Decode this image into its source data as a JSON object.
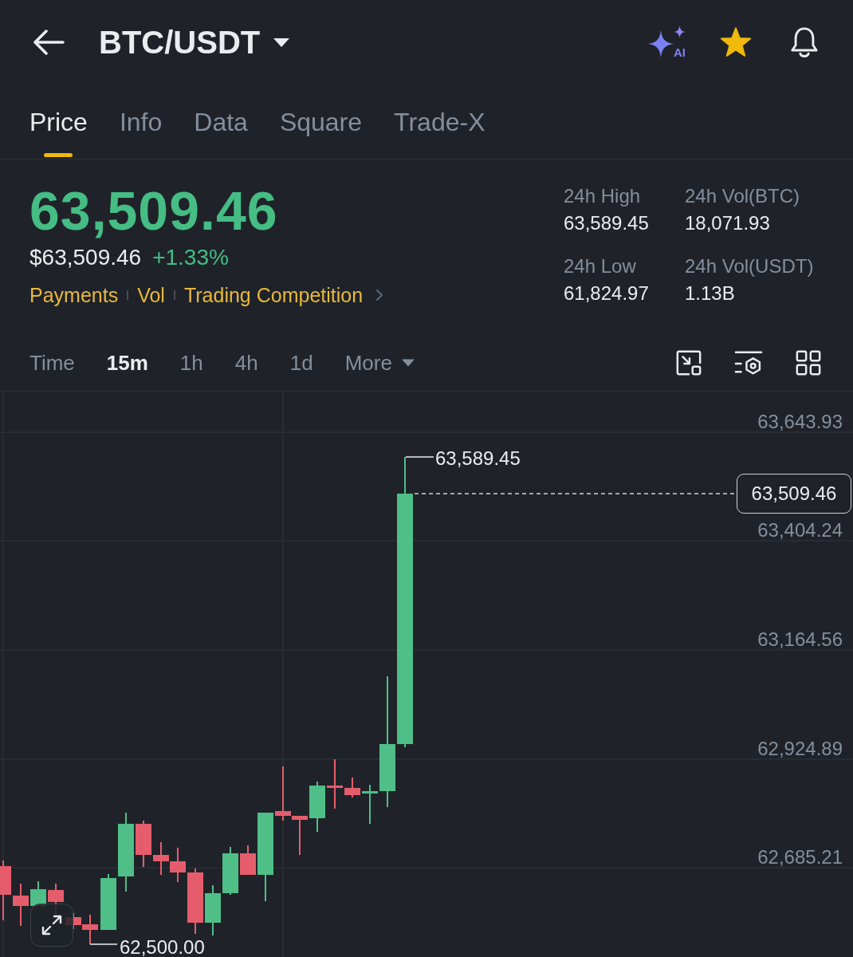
{
  "header": {
    "title": "BTC/USDT",
    "ai_badge": "AI",
    "favorite": true
  },
  "tabs": [
    {
      "label": "Price",
      "selected": true
    },
    {
      "label": "Info",
      "selected": false
    },
    {
      "label": "Data",
      "selected": false
    },
    {
      "label": "Square",
      "selected": false
    },
    {
      "label": "Trade-X",
      "selected": false
    }
  ],
  "ticker": {
    "last_price": "63,509.46",
    "rising": true,
    "usd_price": "$63,509.46",
    "change": "+1.33%",
    "links": [
      "Payments",
      "Vol",
      "Trading Competition"
    ],
    "stats": [
      {
        "label": "24h High",
        "value": "63,589.45"
      },
      {
        "label": "24h Vol(BTC)",
        "value": "18,071.93"
      },
      {
        "label": "24h Low",
        "value": "61,824.97"
      },
      {
        "label": "24h Vol(USDT)",
        "value": "1.13B"
      }
    ]
  },
  "intervals": [
    {
      "label": "Time",
      "selected": false
    },
    {
      "label": "15m",
      "selected": true
    },
    {
      "label": "1h",
      "selected": false
    },
    {
      "label": "4h",
      "selected": false
    },
    {
      "label": "1d",
      "selected": false
    }
  ],
  "more": "More",
  "chart": {
    "price_labels": [
      "63,643.93",
      "63,404.24",
      "63,164.56",
      "62,924.89",
      "62,685.21"
    ],
    "high_label": "63,589.45",
    "last_price_tag": "63,509.46",
    "low_label": "62,500.00"
  }
}
